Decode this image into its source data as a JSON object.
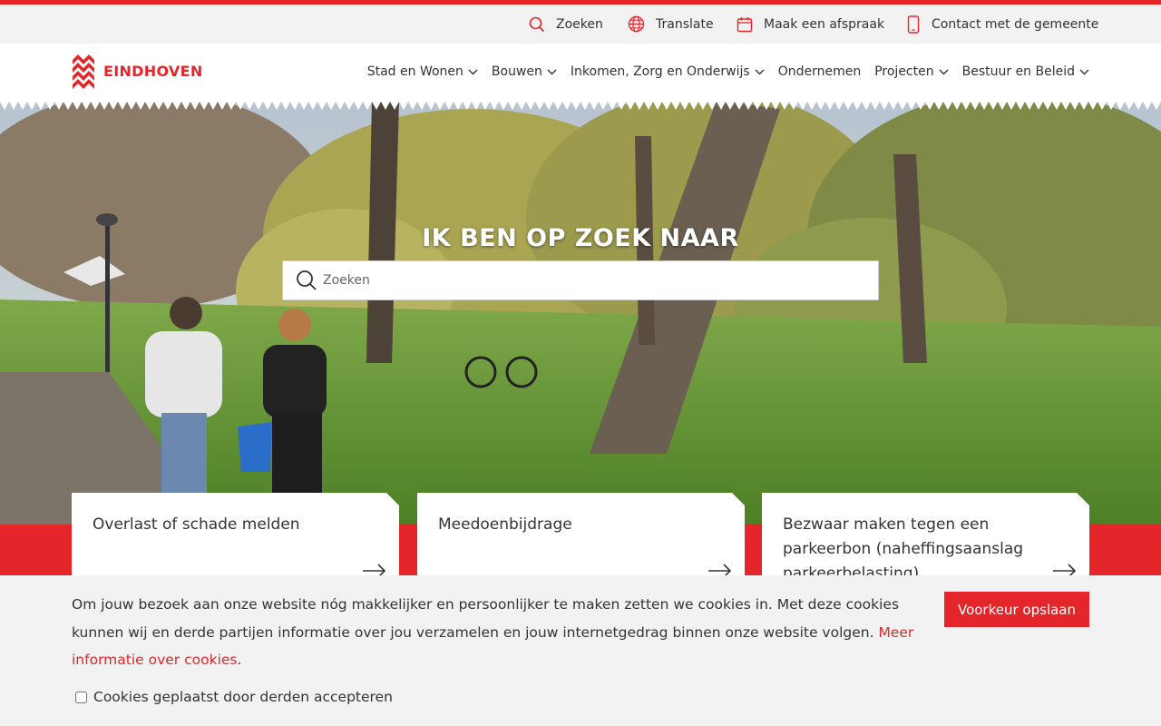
{
  "utility_bar": {
    "items": [
      {
        "label": "Zoeken",
        "icon": "search-icon"
      },
      {
        "label": "Translate",
        "icon": "globe-icon"
      },
      {
        "label": "Maak een afspraak",
        "icon": "calendar-icon"
      },
      {
        "label": "Contact met de gemeente",
        "icon": "phone-icon"
      }
    ]
  },
  "header": {
    "logo_text": "EINDHOVEN",
    "nav": [
      {
        "label": "Stad en Wonen",
        "has_dropdown": true
      },
      {
        "label": "Bouwen",
        "has_dropdown": true
      },
      {
        "label": "Inkomen, Zorg en Onderwijs",
        "has_dropdown": true
      },
      {
        "label": "Ondernemen",
        "has_dropdown": false
      },
      {
        "label": "Projecten",
        "has_dropdown": true
      },
      {
        "label": "Bestuur en Beleid",
        "has_dropdown": true
      }
    ]
  },
  "hero": {
    "title": "IK BEN OP ZOEK NAAR",
    "search_placeholder": "Zoeken"
  },
  "cards": [
    {
      "title": "Overlast of schade melden"
    },
    {
      "title": "Meedoenbijdrage"
    },
    {
      "title": "Bezwaar maken tegen een parkeerbon (naheffingsaanslag parkeerbelasting)"
    }
  ],
  "cookie_banner": {
    "text": "Om jouw bezoek aan onze website nóg makkelijker en persoonlijker te maken zetten we cookies in. Met deze cookies kunnen wij en derde partijen informatie over jou verzamelen en jouw internetgedrag binnen onze website volgen. ",
    "link_text": "Meer informatie over cookies",
    "text_end": ".",
    "button_label": "Voorkeur opslaan",
    "checkbox_label": "Cookies geplaatst door derden accepteren",
    "checkbox_checked": false
  },
  "colors": {
    "brand_red": "#e4262b",
    "utility_bg": "#f2f2f2",
    "text": "#333333"
  }
}
